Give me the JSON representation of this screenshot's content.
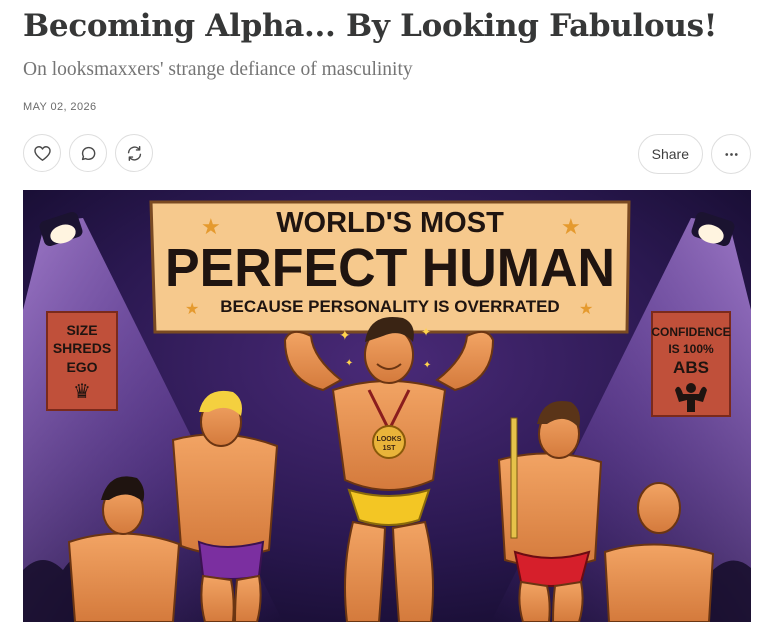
{
  "post": {
    "title": "Becoming Alpha... By Looking Fabulous!",
    "subtitle": "On looksmaxxers' strange defiance of masculinity",
    "date": "MAY 02, 2026"
  },
  "actions": {
    "like_icon": "heart-icon",
    "comment_icon": "comment-icon",
    "restack_icon": "restack-icon",
    "share_label": "Share",
    "more_label": "•••"
  },
  "hero_image": {
    "banner_line1": "WORLD'S MOST",
    "banner_line2": "PERFECT HUMAN",
    "banner_line3": "BECAUSE PERSONALITY IS OVERRATED",
    "left_sign": [
      "SIZE",
      "SHREDS",
      "EGO"
    ],
    "right_sign": [
      "CONFIDENCE",
      "IS 100%",
      "ABS"
    ],
    "medal_text": [
      "LOOKS",
      "1ST"
    ]
  }
}
